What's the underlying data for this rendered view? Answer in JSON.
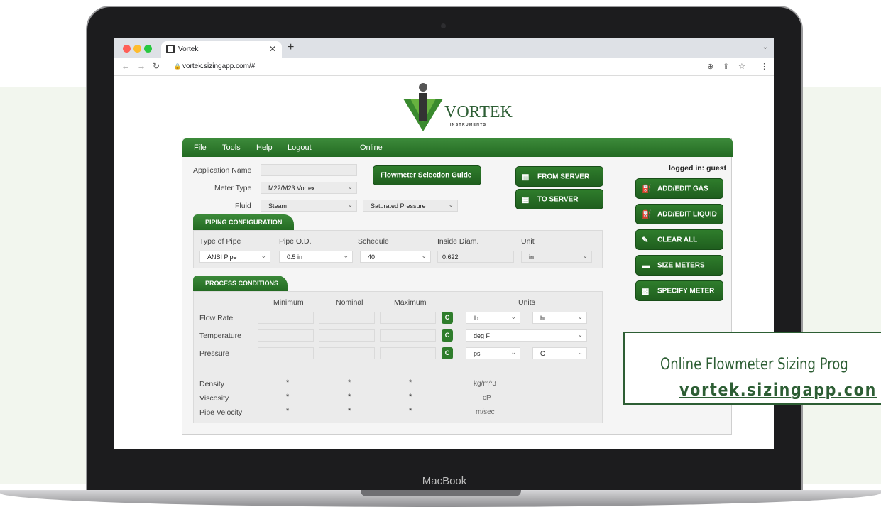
{
  "browser": {
    "tab_title": "Vortek",
    "url": "vortek.sizingapp.com/#"
  },
  "logo": {
    "name": "VORTEK",
    "sub": "I N S T R U M E N T S"
  },
  "menu": {
    "file": "File",
    "tools": "Tools",
    "help": "Help",
    "logout": "Logout",
    "status": "Online"
  },
  "form": {
    "application_name_label": "Application Name",
    "application_name_value": "",
    "meter_type_label": "Meter Type",
    "meter_type_value": "M22/M23 Vortex",
    "fluid_label": "Fluid",
    "fluid_value": "Steam",
    "fluid_state_value": "Saturated Pressure"
  },
  "buttons": {
    "selection_guide": "Flowmeter Selection Guide",
    "from_server": "FROM SERVER",
    "to_server": "TO SERVER",
    "add_edit_gas": "ADD/EDIT GAS",
    "add_edit_liquid": "ADD/EDIT LIQUID",
    "clear_all": "CLEAR ALL",
    "size_meters": "SIZE METERS",
    "specify_meter": "SPECIFY METER"
  },
  "logged_in": "logged in: guest",
  "piping": {
    "tab": "PIPING CONFIGURATION",
    "headers": [
      "Type of Pipe",
      "Pipe O.D.",
      "Schedule",
      "Inside Diam.",
      "Unit"
    ],
    "type_of_pipe": "ANSI Pipe",
    "pipe_od": "0.5 in",
    "schedule": "40",
    "inside_diam": "0.622",
    "unit": "in"
  },
  "process": {
    "tab": "PROCESS CONDITIONS",
    "headers": {
      "min": "Minimum",
      "nom": "Nominal",
      "max": "Maximum",
      "units": "Units"
    },
    "rows": [
      {
        "label": "Flow Rate",
        "c": "C",
        "unit1": "lb",
        "unit2": "hr"
      },
      {
        "label": "Temperature",
        "c": "C",
        "unit1": "deg F"
      },
      {
        "label": "Pressure",
        "c": "C",
        "unit1": "psi",
        "unit2": "G"
      }
    ],
    "results": [
      {
        "label": "Density",
        "v1": "*",
        "v2": "*",
        "v3": "*",
        "unit": "kg/m^3"
      },
      {
        "label": "Viscosity",
        "v1": "*",
        "v2": "*",
        "v3": "*",
        "unit": "cP"
      },
      {
        "label": "Pipe Velocity",
        "v1": "*",
        "v2": "*",
        "v3": "*",
        "unit": "m/sec"
      }
    ]
  },
  "device_label": "MacBook",
  "callout": {
    "line1": "Online Flowmeter Sizing Prog",
    "line2": "vortek.sizingapp.con"
  },
  "colors": {
    "brand_green": "#2f7d2c",
    "page_bg": "#f2f6ee",
    "callout_green": "#2d5e34"
  }
}
